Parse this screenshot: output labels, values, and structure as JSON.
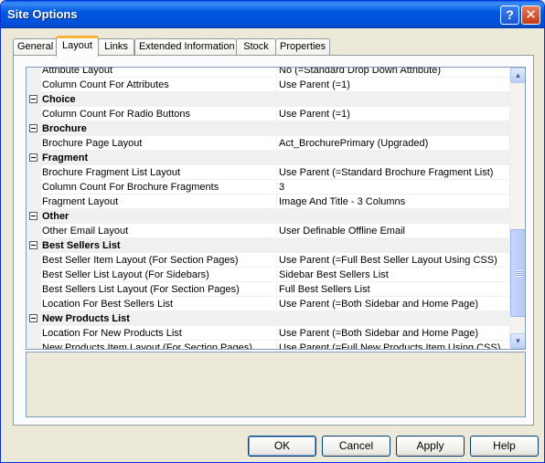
{
  "window": {
    "title": "Site Options"
  },
  "tabs": [
    {
      "label": "General"
    },
    {
      "label": "Layout"
    },
    {
      "label": "Links"
    },
    {
      "label": "Extended Information"
    },
    {
      "label": "Stock"
    },
    {
      "label": "Properties"
    }
  ],
  "grid": {
    "rows": [
      {
        "kind": "prop",
        "name": "Attribute Layout",
        "value": "No (=Standard Drop Down Attribute)"
      },
      {
        "kind": "prop",
        "name": "Column Count For Attributes",
        "value": "Use Parent (=1)"
      },
      {
        "kind": "cat",
        "name": "Choice"
      },
      {
        "kind": "prop",
        "name": "Column Count For Radio Buttons",
        "value": "Use Parent (=1)"
      },
      {
        "kind": "cat",
        "name": "Brochure"
      },
      {
        "kind": "prop",
        "name": "Brochure Page Layout",
        "value": "Act_BrochurePrimary (Upgraded)"
      },
      {
        "kind": "cat",
        "name": "Fragment"
      },
      {
        "kind": "prop",
        "name": "Brochure Fragment List Layout",
        "value": "Use Parent (=Standard Brochure Fragment List)"
      },
      {
        "kind": "prop",
        "name": "Column Count For Brochure Fragments",
        "value": "3"
      },
      {
        "kind": "prop",
        "name": "Fragment Layout",
        "value": "Image And Title - 3 Columns"
      },
      {
        "kind": "cat",
        "name": "Other"
      },
      {
        "kind": "prop",
        "name": "Other Email Layout",
        "value": "User Definable Offline Email"
      },
      {
        "kind": "cat",
        "name": "Best Sellers List"
      },
      {
        "kind": "prop",
        "name": "Best Seller Item Layout (For Section Pages)",
        "value": "Use Parent (=Full Best Seller Layout Using CSS)"
      },
      {
        "kind": "prop",
        "name": "Best Seller List Layout (For Sidebars)",
        "value": "Sidebar Best Sellers List"
      },
      {
        "kind": "prop",
        "name": "Best Sellers List Layout (For Section Pages)",
        "value": "Full Best Sellers List"
      },
      {
        "kind": "prop",
        "name": "Location For Best Sellers List",
        "value": "Use Parent (=Both Sidebar and Home Page)"
      },
      {
        "kind": "cat",
        "name": "New Products List"
      },
      {
        "kind": "prop",
        "name": "Location For New Products List",
        "value": "Use Parent (=Both Sidebar and Home Page)"
      },
      {
        "kind": "prop",
        "name": "New Products Item Layout (For Section Pages)",
        "value": "Use Parent (=Full New Products Item Using CSS)"
      }
    ]
  },
  "buttons": {
    "ok": "OK",
    "cancel": "Cancel",
    "apply": "Apply",
    "help": "Help"
  }
}
